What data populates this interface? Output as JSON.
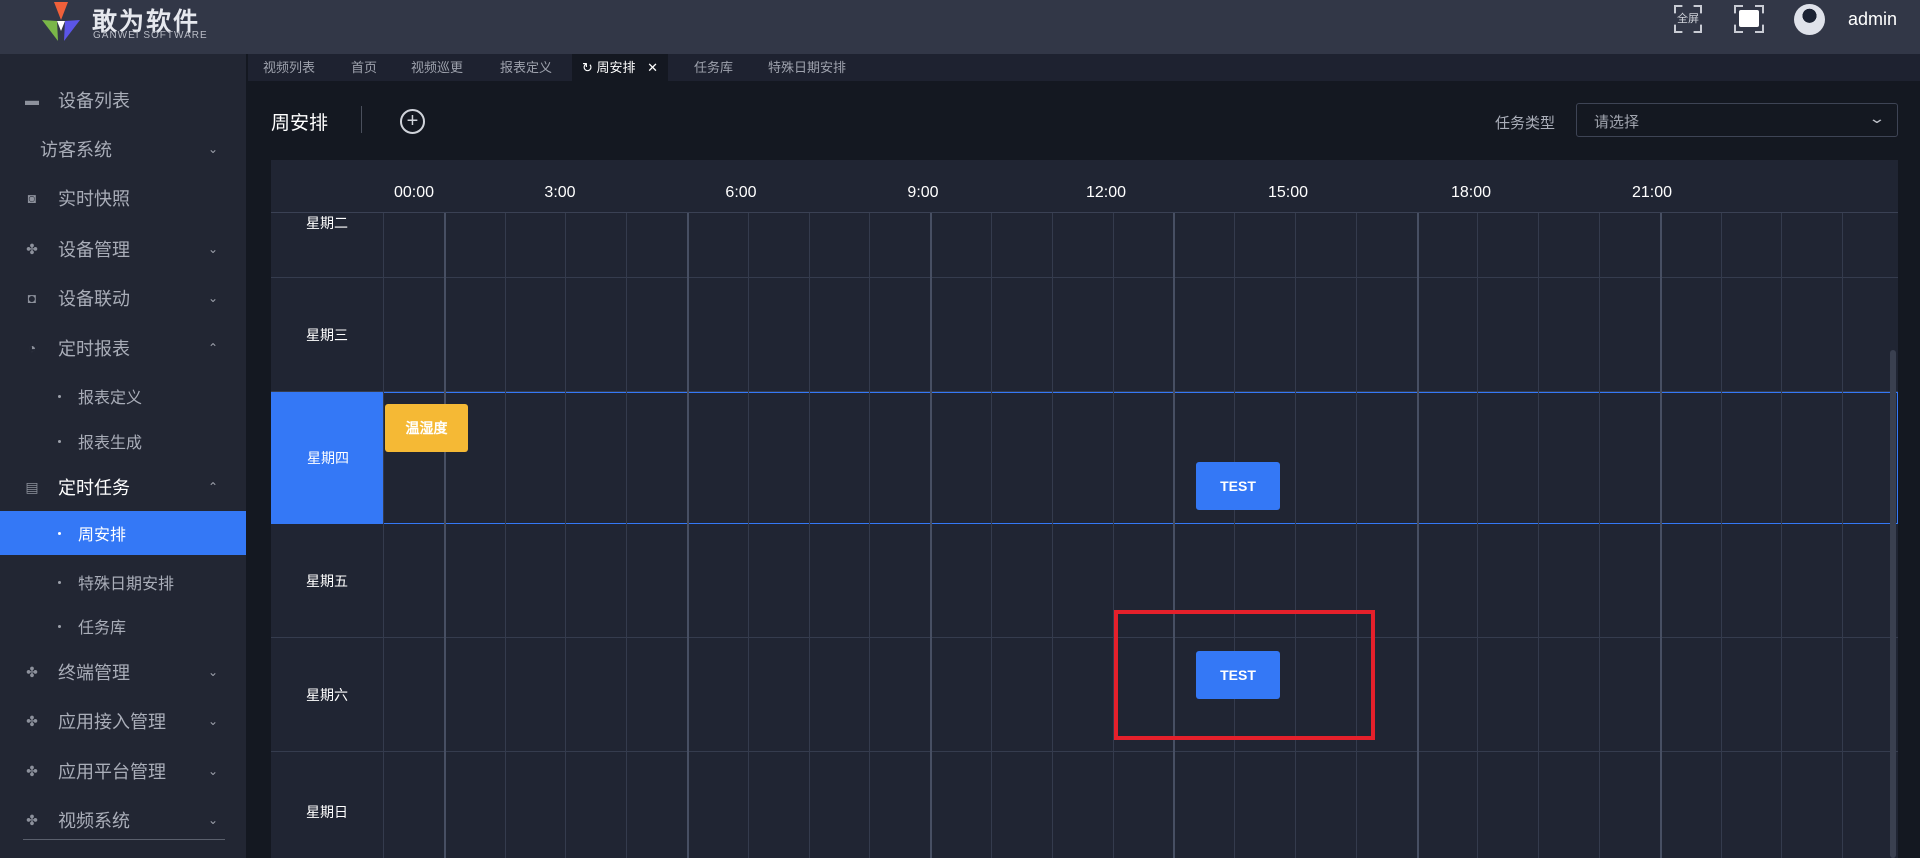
{
  "header": {
    "brand": "敢为软件",
    "brand_sub": "GANWEI SOFTWARE",
    "fullscreen_label": "全屏",
    "username": "admin"
  },
  "sidebar": {
    "items": [
      {
        "label": "设备列表",
        "icon": "monitor-icon"
      },
      {
        "label": "访客系统"
      },
      {
        "label": "实时快照",
        "icon": "camera-icon"
      },
      {
        "label": "设备管理",
        "icon": "grid-icon"
      },
      {
        "label": "设备联动",
        "icon": "link-icon"
      },
      {
        "label": "定时报表",
        "icon": "clock-icon"
      },
      {
        "label": "报表定义"
      },
      {
        "label": "报表生成"
      },
      {
        "label": "定时任务",
        "icon": "task-icon"
      },
      {
        "label": "周安排"
      },
      {
        "label": "特殊日期安排"
      },
      {
        "label": "任务库"
      },
      {
        "label": "终端管理",
        "icon": "grid-icon"
      },
      {
        "label": "应用接入管理",
        "icon": "grid-icon"
      },
      {
        "label": "应用平台管理",
        "icon": "grid-icon"
      },
      {
        "label": "视频系统",
        "icon": "grid-icon"
      }
    ]
  },
  "tabs": [
    "视频列表",
    "首页",
    "视频巡更",
    "报表定义",
    "周安排",
    "任务库",
    "特殊日期安排"
  ],
  "main": {
    "title": "周安排",
    "filter_label": "任务类型",
    "filter_placeholder": "请选择"
  },
  "schedule": {
    "times": [
      "00:00",
      "3:00",
      "6:00",
      "9:00",
      "12:00",
      "15:00",
      "18:00",
      "21:00"
    ],
    "days": [
      "星期二",
      "星期三",
      "星期四",
      "星期五",
      "星期六",
      "星期日"
    ],
    "selected_day": "星期四",
    "events": [
      {
        "day": "星期四",
        "label": "温湿度",
        "color": "#f5b935"
      },
      {
        "day": "星期四",
        "label": "TEST",
        "color": "#3478f6"
      },
      {
        "day": "星期六",
        "label": "TEST",
        "color": "#3478f6"
      }
    ]
  },
  "colors": {
    "accent": "#3478f6",
    "highlight": "#e5202b"
  }
}
